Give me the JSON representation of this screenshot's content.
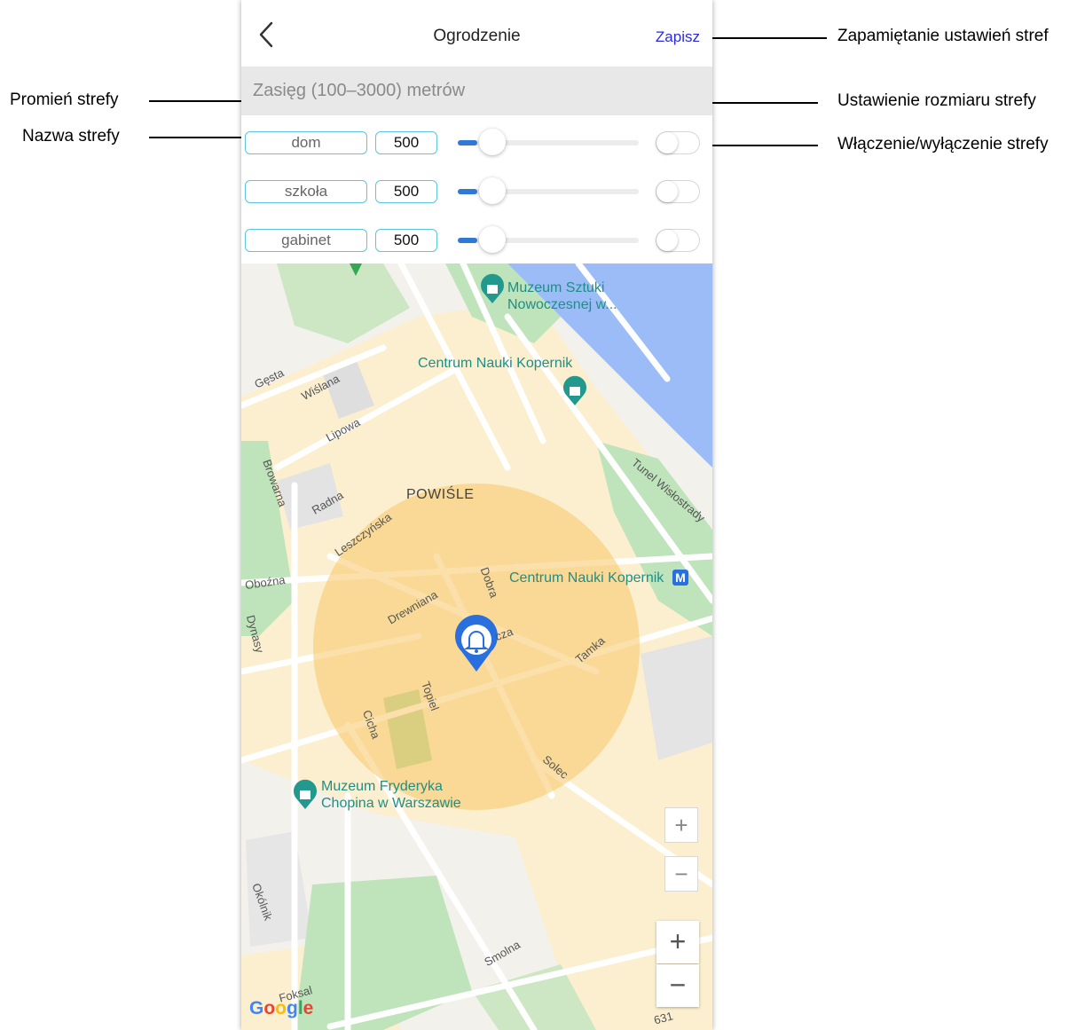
{
  "header": {
    "title": "Ogrodzenie",
    "save_label": "Zapisz",
    "back_icon": "chevron-left-icon"
  },
  "range": {
    "label": "Zasięg (100–3000) metrów"
  },
  "zones": [
    {
      "name": "dom",
      "radius": "500",
      "slider_fraction": 0.0,
      "enabled": false
    },
    {
      "name": "szkoła",
      "radius": "500",
      "slider_fraction": 0.0,
      "enabled": false
    },
    {
      "name": "gabinet",
      "radius": "500",
      "slider_fraction": 0.0,
      "enabled": false
    }
  ],
  "annotations": {
    "save": "Zapamiętanie ustawień stref",
    "radius": "Promień strefy",
    "size": "Ustawienie rozmiaru strefy",
    "name": "Nazwa strefy",
    "toggle": "Włączenie/wyłączenie strefy"
  },
  "map": {
    "district": "POWIŚLE",
    "poi": {
      "museum_modern": "Muzeum Sztuki\nNowoczesnej w...",
      "kopernik_center": "Centrum Nauki Kopernik",
      "kopernik_metro": "Centrum Nauki Kopernik",
      "metro_badge": "M",
      "chopin_museum": "Muzeum Fryderyka\nChopina w Warszawie"
    },
    "streets": {
      "gesta": "Gęsta",
      "wislana": "Wiślana",
      "lipowa": "Lipowa",
      "browarna": "Browarna",
      "radna": "Radna",
      "leszczynska": "Leszczyńska",
      "obozna": "Oboźna",
      "drewniana": "Drewniana",
      "dobra": "Dobra",
      "tamka": "Tamka",
      "za": "cza",
      "dynasy": "Dynasy",
      "topiel": "Topiel",
      "cicha": "Cicha",
      "solec": "Solec",
      "tunel": "Tunel Wisłostrady",
      "okolnik": "Okólnik",
      "smolna": "Smolna",
      "foksal": "Foksal",
      "route": "631"
    },
    "zoom_in": "+",
    "zoom_out": "−",
    "google_logo": [
      "G",
      "o",
      "o",
      "g",
      "l",
      "e"
    ],
    "colors": {
      "geofence": "#f7c766",
      "water": "#9bbcf6",
      "park": "#a9dcae",
      "marker": "#2a6fde"
    }
  }
}
